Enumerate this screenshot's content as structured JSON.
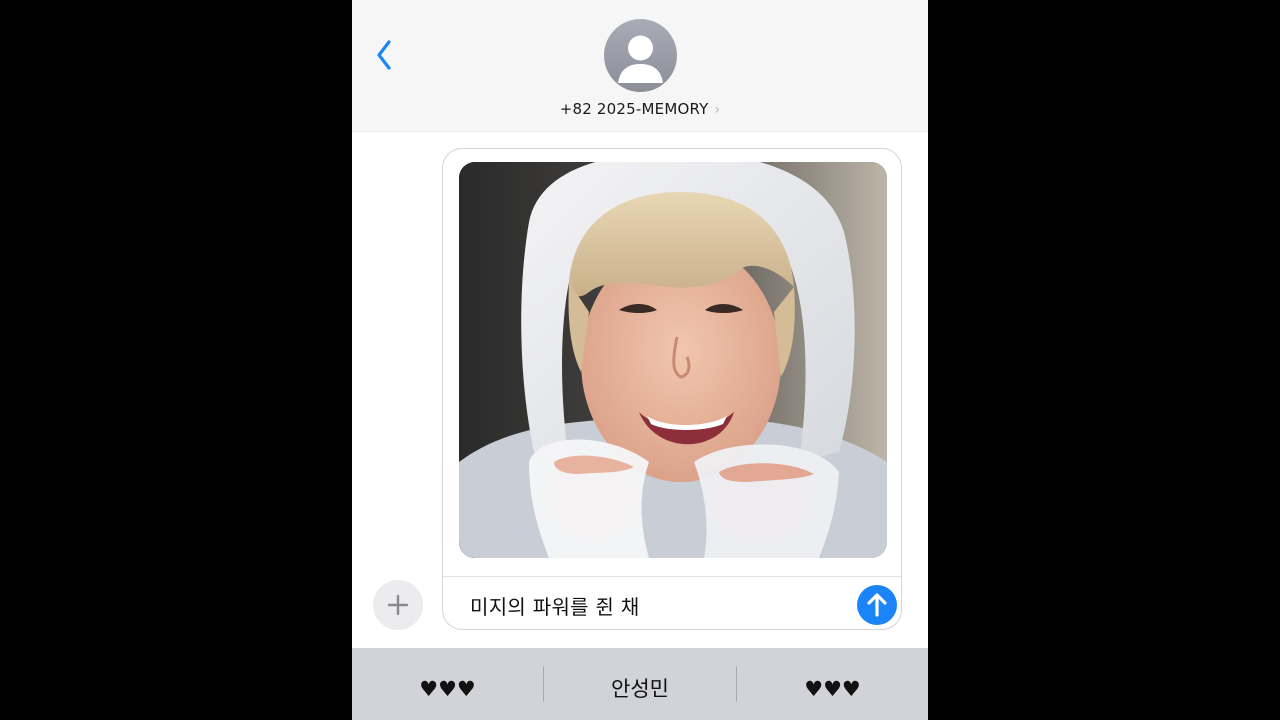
{
  "header": {
    "contact_name": "+82 2025-MEMORY",
    "chevron": "›"
  },
  "composer": {
    "message_text": "미지의 파워를 쥔 채"
  },
  "suggestions": {
    "items": [
      "♥♥♥",
      "안성민",
      "♥♥♥"
    ]
  },
  "icons": {
    "back": "chevron-left-icon",
    "avatar": "person-silhouette-icon",
    "send": "arrow-up-icon",
    "add": "plus-icon"
  },
  "colors": {
    "accent": "#1a84f8",
    "header_bg": "#f6f6f6",
    "suggest_bg": "#d1d3d9"
  }
}
